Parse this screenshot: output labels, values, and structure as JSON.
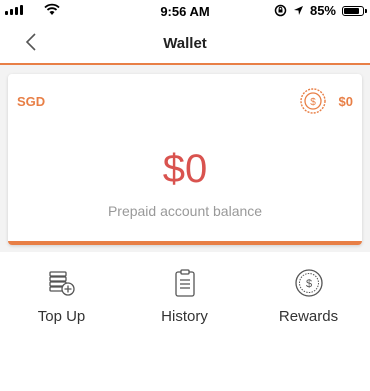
{
  "status_bar": {
    "time": "9:56 AM",
    "battery": "85%",
    "battery_level": 0.85,
    "icons": [
      "signal-icon",
      "wifi-icon",
      "rotation-lock-icon",
      "location-icon",
      "battery-icon"
    ]
  },
  "header": {
    "title": "Wallet",
    "back_icon": "chevron-left-icon"
  },
  "wallet_card": {
    "currency": "SGD",
    "reward_icon": "dollar-coin-icon",
    "reward_amount": "$0",
    "balance": "$0",
    "balance_label": "Prepaid account balance"
  },
  "actions": [
    {
      "label": "Top Up",
      "icon": "coins-plus-icon"
    },
    {
      "label": "History",
      "icon": "clipboard-icon"
    },
    {
      "label": "Rewards",
      "icon": "dollar-coin-icon"
    }
  ],
  "colors": {
    "accent": "#e87f46",
    "balance": "#d9534f",
    "muted_text": "#999999"
  }
}
